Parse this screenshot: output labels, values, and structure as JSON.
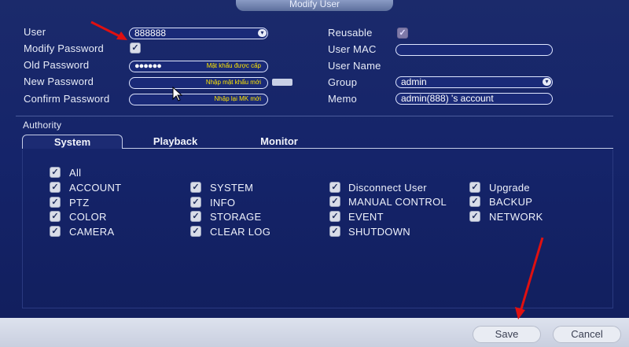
{
  "window": {
    "title": "Modify User"
  },
  "left": {
    "user_label": "User",
    "user_value": "888888",
    "modify_password_label": "Modify Password",
    "old_password_label": "Old Password",
    "old_password_dots": "●●●●●●",
    "old_password_hint": "Mật khẩu được cấp",
    "new_password_label": "New Password",
    "new_password_hint": "Nhập mật khẩu mới",
    "confirm_password_label": "Confirm Password",
    "confirm_password_hint": "Nhập lại MK mới"
  },
  "right": {
    "reusable_label": "Reusable",
    "user_mac_label": "User MAC",
    "user_mac_value": "",
    "user_name_label": "User Name",
    "group_label": "Group",
    "group_value": "admin",
    "memo_label": "Memo",
    "memo_value": "admin(888) 's account"
  },
  "authority": {
    "title": "Authority",
    "tabs": [
      "System",
      "Playback",
      "Monitor"
    ],
    "all_label": "All",
    "columns": [
      [
        "ACCOUNT",
        "PTZ",
        "COLOR",
        "CAMERA"
      ],
      [
        "SYSTEM",
        "INFO",
        "STORAGE",
        "CLEAR LOG"
      ],
      [
        "Disconnect User",
        "MANUAL CONTROL",
        "EVENT",
        "SHUTDOWN"
      ],
      [
        "Upgrade",
        "BACKUP",
        "NETWORK"
      ]
    ]
  },
  "buttons": {
    "save": "Save",
    "cancel": "Cancel"
  },
  "icons": {
    "checkmark": "✓",
    "dropdown": "▾"
  },
  "colors": {
    "panel": "#15246a",
    "arrow": "#e01010",
    "hint_text": "#ffe600"
  }
}
